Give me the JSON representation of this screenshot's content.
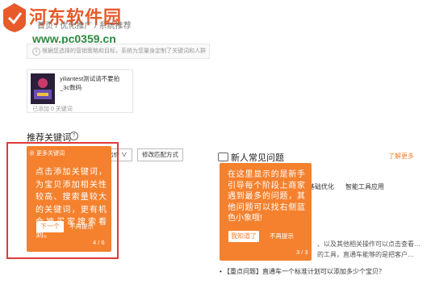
{
  "watermark": {
    "title": "河东软件园",
    "url": "www.pc0359.cn"
  },
  "breadcrumb": "首页 / 优化推广 / 系统推荐",
  "tip": {
    "icon": "info-icon",
    "text": "根据您选择的营销策略和目标，系统为您量身定制了关键词和人群"
  },
  "product": {
    "title": "yiliantest测试请不要拍_3c数码",
    "meta": "已添加  0 关键词"
  },
  "section": {
    "title": "推荐关键词",
    "help_icon": "?"
  },
  "tour_step1": {
    "chip": "更多关键词",
    "text": "点击添加关键词，为宝贝添加相关性较高、搜索量较大的关键词，更有机会被买家搜索看到。",
    "next_label": "下一个",
    "skip_label": "不再提示",
    "counter": "4 / 6"
  },
  "toolbar": {
    "bid_select_label": "批量修改出价",
    "bid_select_caret": "∨",
    "match_button_label": "修改匹配方式"
  },
  "newbie": {
    "title": "新人常见问题",
    "more_label": "了解更多",
    "tabs": [
      "基础优化",
      "智能工具应用"
    ],
    "lines": [
      "、以及其他相关操作可以点击查看…",
      "的工具，直通车能够的是把客户…"
    ],
    "bottom_item": "• 【重点问题】直通车一个标准计划可以添加多少个宝贝？"
  },
  "tour_step2": {
    "text": "在这里显示的是新手引导每个阶段上商家遇到最多的问题，其他问题可以找右侧蓝色小象哦!",
    "got_label": "我知道了",
    "skip_label": "不再提示",
    "counter": "3 / 3"
  },
  "colors": {
    "accent": "#f5812e",
    "highlight": "#e03a3a",
    "watermark_title": "#e85a2a",
    "watermark_url": "#2a8a3e"
  }
}
